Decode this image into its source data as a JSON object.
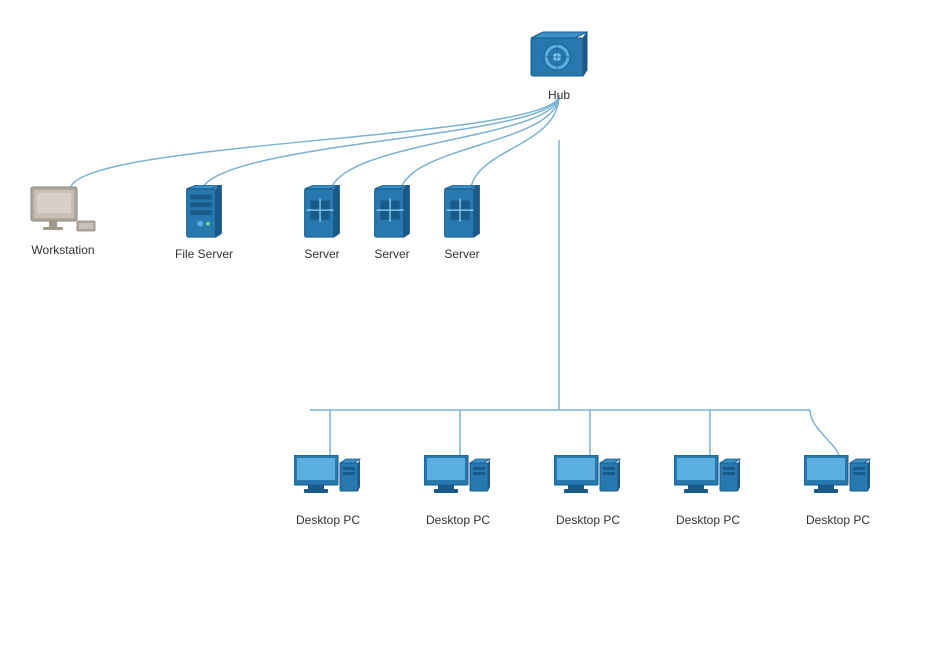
{
  "nodes": {
    "hub": {
      "label": "Hub"
    },
    "workstation": {
      "label": "Workstation"
    },
    "fileServer": {
      "label": "File Server"
    },
    "server1": {
      "label": "Server"
    },
    "server2": {
      "label": "Server"
    },
    "server3": {
      "label": "Server"
    },
    "desktop1": {
      "label": "Desktop PC"
    },
    "desktop2": {
      "label": "Desktop PC"
    },
    "desktop3": {
      "label": "Desktop PC"
    },
    "desktop4": {
      "label": "Desktop PC"
    },
    "desktop5": {
      "label": "Desktop PC"
    }
  }
}
